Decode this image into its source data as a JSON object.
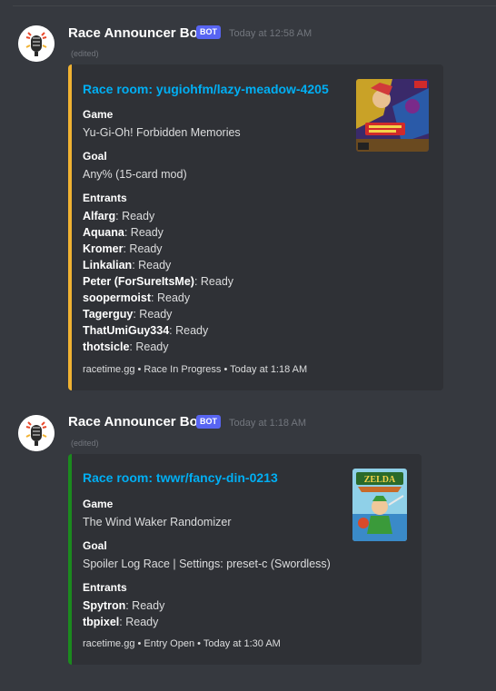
{
  "messages": [
    {
      "author": "Race Announcer Bot",
      "bot_tag": "BOT",
      "timestamp": "Today at 12:58 AM",
      "edited": "(edited)",
      "embed": {
        "title": "Race room: yugiohfm/lazy-meadow-4205",
        "game_label": "Game",
        "game": "Yu-Gi-Oh! Forbidden Memories",
        "goal_label": "Goal",
        "goal": "Any% (15-card mod)",
        "entrants_label": "Entrants",
        "entrants": [
          {
            "name": "Alfarg",
            "status": ": Ready"
          },
          {
            "name": "Aquana",
            "status": ": Ready"
          },
          {
            "name": "Kromer",
            "status": ": Ready"
          },
          {
            "name": "Linkalian",
            "status": ": Ready"
          },
          {
            "name": "Peter (ForSureItsMe)",
            "status": ": Ready"
          },
          {
            "name": "soopermoist",
            "status": ": Ready"
          },
          {
            "name": "Tagerguy",
            "status": ": Ready"
          },
          {
            "name": "ThatUmiGuy334",
            "status": ": Ready"
          },
          {
            "name": "thotsicle",
            "status": ": Ready"
          }
        ],
        "footer": "racetime.gg • Race In Progress • Today at 1:18 AM",
        "accent_color": "#f0b232"
      }
    },
    {
      "author": "Race Announcer Bot",
      "bot_tag": "BOT",
      "timestamp": "Today at 1:18 AM",
      "edited": "(edited)",
      "embed": {
        "title": "Race room: twwr/fancy-din-0213",
        "game_label": "Game",
        "game": "The Wind Waker Randomizer",
        "goal_label": "Goal",
        "goal": "Spoiler Log Race | Settings: preset-c (Swordless)",
        "entrants_label": "Entrants",
        "entrants": [
          {
            "name": "Spytron",
            "status": ": Ready"
          },
          {
            "name": "tbpixel",
            "status": ": Ready"
          }
        ],
        "footer": "racetime.gg • Entry Open • Today at 1:30 AM",
        "accent_color": "#1b8a1e"
      }
    }
  ],
  "icons": {
    "avatar": "announcer-microphone-icon",
    "thumbnail_1": "yugioh-forbidden-memories-cover",
    "thumbnail_2": "zelda-wind-waker-cover"
  },
  "colors": {
    "background": "#36393f",
    "embed_bg": "#2f3136",
    "link": "#00aff4",
    "bot_tag": "#5865f2"
  }
}
